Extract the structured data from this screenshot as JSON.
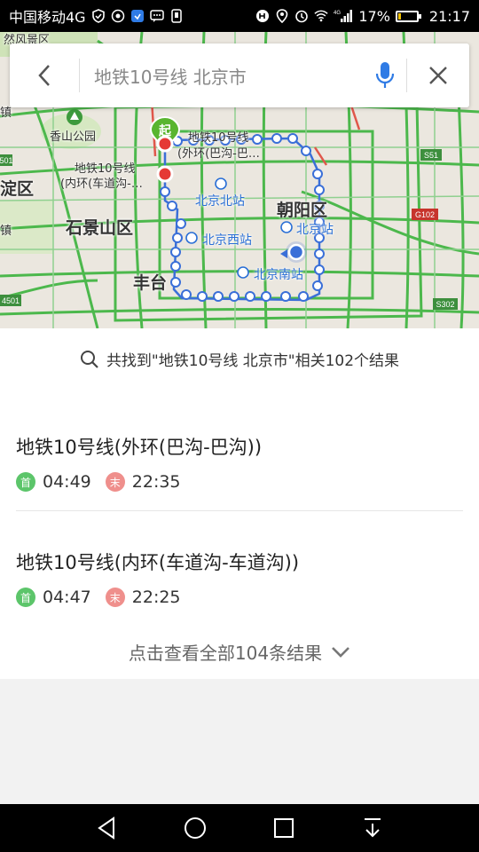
{
  "status_bar": {
    "carrier": "中国移动4G",
    "battery_percent": "17%",
    "battery_level": 0.17,
    "time": "21:17",
    "network_small": "4G"
  },
  "map": {
    "labels": {
      "fengjing": "然风景区",
      "xiangshan": "香山公园",
      "line_outer": "地铁10号线",
      "line_outer_sub": "(外环(巴沟-巴…",
      "line_inner": "地铁10号线",
      "line_inner_sub": "(内环(车道沟-…",
      "start_marker": "起",
      "district_left": "淀区",
      "shijingshan": "石景山区",
      "fengtai": "丰台",
      "chaoyang": "朝阳区",
      "bj_north": "北京北站",
      "bj_west": "北京西站",
      "bj_south": "北京南站",
      "bj_station": "北京站",
      "town": "镇",
      "town2": "镇",
      "road_s51": "S51",
      "road_g102": "G102",
      "road_s302": "S302",
      "road_4501": "4501",
      "road_s501": "501",
      "road_g4501": "4501"
    }
  },
  "search": {
    "query": "地铁10号线 北京市"
  },
  "results": {
    "summary": "共找到\"地铁10号线 北京市\"相关102个结果",
    "items": [
      {
        "title": "地铁10号线(外环(巴沟-巴沟))",
        "first_tag": "首",
        "first_time": "04:49",
        "last_tag": "末",
        "last_time": "22:35"
      },
      {
        "title": "地铁10号线(内环(车道沟-车道沟))",
        "first_tag": "首",
        "first_time": "04:47",
        "last_tag": "末",
        "last_time": "22:25"
      }
    ],
    "show_all": "点击查看全部104条结果"
  },
  "icons": {
    "back": "back-arrow-icon",
    "mic": "microphone-icon",
    "close": "close-icon",
    "search": "search-icon",
    "chevron": "chevron-down-icon",
    "nav_back": "triangle-back-icon",
    "nav_home": "circle-home-icon",
    "nav_recent": "square-recent-icon",
    "nav_notify": "pull-down-icon"
  },
  "colors": {
    "route_blue": "#3a6fd8",
    "tag_first": "#5cc56a",
    "tag_last": "#ef8f8c",
    "mic_blue": "#2f7be5",
    "marker_green": "#59b52f",
    "marker_red": "#e53935"
  }
}
